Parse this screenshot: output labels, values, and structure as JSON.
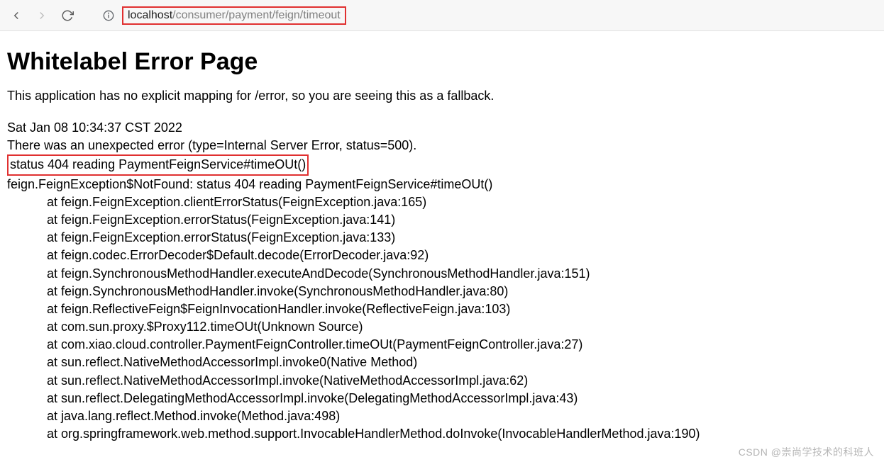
{
  "url": {
    "host": "localhost",
    "path": "/consumer/payment/feign/timeout"
  },
  "page": {
    "title": "Whitelabel Error Page",
    "subtitle": "This application has no explicit mapping for /error, so you are seeing this as a fallback.",
    "timestamp": "Sat Jan 08 10:34:37 CST 2022",
    "error_summary": "There was an unexpected error (type=Internal Server Error, status=500).",
    "error_status_line": "status 404 reading PaymentFeignService#timeOUt()",
    "exception_line": "feign.FeignException$NotFound: status 404 reading PaymentFeignService#timeOUt()",
    "stack": [
      "at feign.FeignException.clientErrorStatus(FeignException.java:165)",
      "at feign.FeignException.errorStatus(FeignException.java:141)",
      "at feign.FeignException.errorStatus(FeignException.java:133)",
      "at feign.codec.ErrorDecoder$Default.decode(ErrorDecoder.java:92)",
      "at feign.SynchronousMethodHandler.executeAndDecode(SynchronousMethodHandler.java:151)",
      "at feign.SynchronousMethodHandler.invoke(SynchronousMethodHandler.java:80)",
      "at feign.ReflectiveFeign$FeignInvocationHandler.invoke(ReflectiveFeign.java:103)",
      "at com.sun.proxy.$Proxy112.timeOUt(Unknown Source)",
      "at com.xiao.cloud.controller.PaymentFeignController.timeOUt(PaymentFeignController.java:27)",
      "at sun.reflect.NativeMethodAccessorImpl.invoke0(Native Method)",
      "at sun.reflect.NativeMethodAccessorImpl.invoke(NativeMethodAccessorImpl.java:62)",
      "at sun.reflect.DelegatingMethodAccessorImpl.invoke(DelegatingMethodAccessorImpl.java:43)",
      "at java.lang.reflect.Method.invoke(Method.java:498)",
      "at org.springframework.web.method.support.InvocableHandlerMethod.doInvoke(InvocableHandlerMethod.java:190)"
    ]
  },
  "watermark": "CSDN @崇尚学技术的科班人"
}
